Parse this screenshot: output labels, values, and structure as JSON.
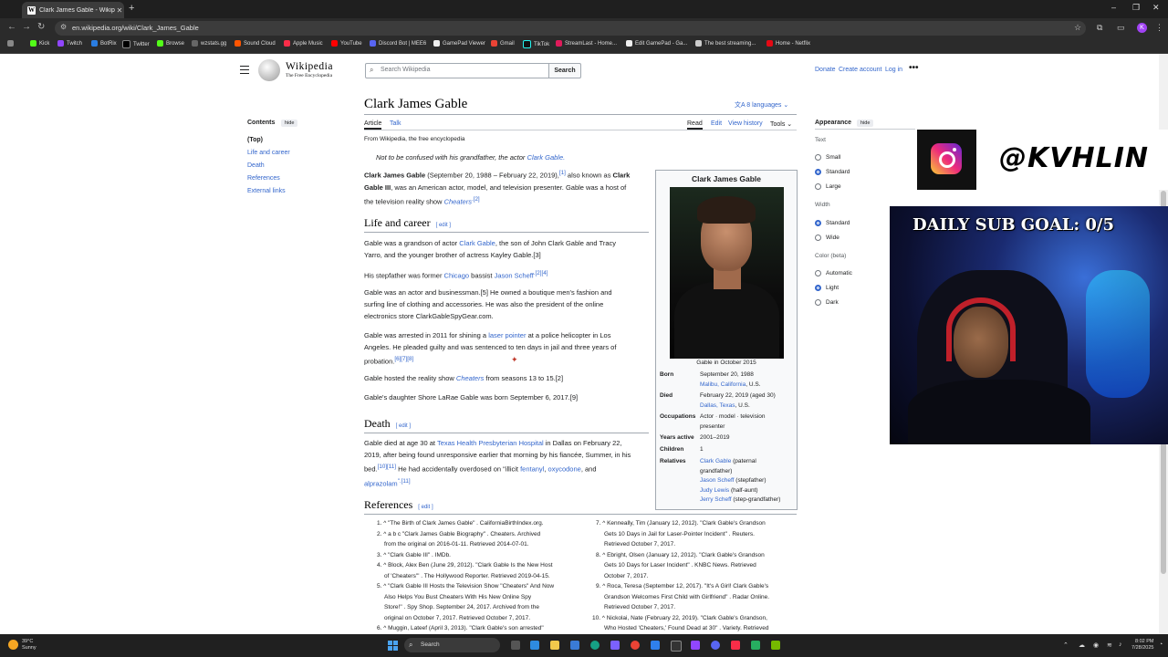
{
  "browser": {
    "tab_title": "Clark James Gable - Wikipedia",
    "url": "en.wikipedia.org/wiki/Clark_James_Gable",
    "bookmarks": [
      "Kick",
      "Twitch",
      "BotRix",
      "Twitter",
      "Browse",
      "wzstats.gg",
      "Sound Cloud",
      "Apple Music",
      "YouTube",
      "Discord Bot | MEE6",
      "GamePad Viewer",
      "Gmail",
      "TikTok",
      "StreamLast - Home...",
      "Edit GamePad - Ga...",
      "The best streaming...",
      "Home - Netflix"
    ],
    "profile_initial": "K"
  },
  "wiki": {
    "wordmark": "Wikipedia",
    "tagline_logo": "The Free Encyclopedia",
    "search_placeholder": "Search Wikipedia",
    "search_button": "Search",
    "top_links": [
      "Donate",
      "Create account",
      "Log in"
    ],
    "toc": {
      "heading": "Contents",
      "hide": "hide",
      "items": [
        "(Top)",
        "Life and career",
        "Death",
        "References",
        "External links"
      ]
    },
    "title": "Clark James Gable",
    "languages": "8 languages",
    "tabs": {
      "article": "Article",
      "talk": "Talk",
      "read": "Read",
      "edit": "Edit",
      "history": "View history",
      "tools": "Tools"
    },
    "from": "From Wikipedia, the free encyclopedia",
    "hatnote_prefix": "Not to be confused with his grandfather, the actor ",
    "hatnote_link": "Clark Gable.",
    "intro": {
      "l1a": "Clark James Gable",
      "l1b": " (September 20, 1988 – February 22, 2019),",
      "l1c": "[1]",
      "l1d": " also known as ",
      "l1e": "Clark",
      "l2a": "Gable III",
      "l2b": ", was an American actor, model, and television presenter. Gable was a host of",
      "l3a": "the television reality show ",
      "l3b": "Cheaters",
      "l3c": ".[2]"
    },
    "sections": {
      "life": "Life and career",
      "death": "Death",
      "references": "References",
      "edit": "[ edit ]"
    },
    "life_paragraphs": {
      "p1l1a": "Gable was a grandson of actor ",
      "p1l1b": "Clark Gable",
      "p1l1c": ", the son of John Clark Gable and Tracy",
      "p1l2": "Yarro, and the younger brother of actress Kayley Gable.[3]",
      "p2a": "His stepfather was former ",
      "p2b": "Chicago",
      "p2c": " bassist ",
      "p2d": "Jason Scheff",
      "p2e": ".[2][4]",
      "p3l1": "Gable was an actor and businessman.[5] He owned a boutique men's fashion and",
      "p3l2": "surfing line of clothing and accessories. He was also the president of the online",
      "p3l3": "electronics store ClarkGableSpyGear.com.",
      "p4l1a": "Gable was arrested in 2011 for shining a ",
      "p4l1b": "laser pointer",
      "p4l1c": " at a police helicopter in Los",
      "p4l2": "Angeles. He pleaded guilty and was sentenced to ten days in jail and three years of",
      "p4l3a": "probation.",
      "p4l3b": "[6][7][8]",
      "p5a": "Gable hosted the reality show ",
      "p5b": "Cheaters",
      "p5c": " from seasons 13 to 15.[2]",
      "p6": "Gable's daughter Shore LaRae Gable was born September 6, 2017.[9]"
    },
    "death_paragraph": {
      "l1a": "Gable died at age 30 at ",
      "l1b": "Texas Health Presbyterian Hospital",
      "l1c": " in Dallas on February 22,",
      "l2": "2019, after being found unresponsive earlier that morning by his fiancée, Summer, in his",
      "l3a": "bed.",
      "l3b": "[10][11]",
      "l3c": " He had accidentally overdosed on \"illicit ",
      "l3d": "fentanyl",
      "l3e": ", ",
      "l3f": "oxycodone",
      "l3g": ", and",
      "l4a": "alprazolam",
      "l4b": "\".[11]"
    },
    "infobox": {
      "title": "Clark James Gable",
      "caption": "Gable in October 2015",
      "born_label": "Born",
      "born_date": "September 20, 1988",
      "born_place_link": "Malibu, California",
      "born_place_rest": ", U.S.",
      "died_label": "Died",
      "died_date": "February 22, 2019 (aged 30)",
      "died_place_link": "Dallas, Texas",
      "died_place_rest": ", U.S.",
      "occ_label": "Occupations",
      "occ_l1": "Actor · model · television",
      "occ_l2": "presenter",
      "years_label": "Years active",
      "years": "2001–2019",
      "children_label": "Children",
      "children": "1",
      "relatives_label": "Relatives",
      "rel1_link": "Clark Gable",
      "rel1_rest": " (paternal",
      "rel1_l2": "grandfather)",
      "rel2_link": "Jason Scheff",
      "rel2_rest": " (stepfather)",
      "rel3_link": "Judy Lewis",
      "rel3_rest": " (half-aunt)",
      "rel4_link": "Jerry Scheff",
      "rel4_rest": " (step-grandfather)"
    },
    "references_left": [
      "1. ^ \"The Birth of Clark James Gable\" . CaliforniaBirthIndex.org.",
      "2. ^ a b c \"Clark James Gable Biography\" . Cheaters. Archived",
      "from the original on 2016-01-11. Retrieved 2014-07-01.",
      "3. ^ \"Clark Gable III\" . IMDb.",
      "4. ^ Block, Alex Ben (June 29, 2012). \"Clark Gable Is the New Host",
      "of 'Cheaters'\" . The Hollywood Reporter. Retrieved 2019-04-15.",
      "5. ^ \"Clark Gable III Hosts the Television Show \"Cheaters\" And Now",
      "Also Helps You Bust Cheaters With His New Online Spy",
      "Store!\" . Spy Shop. September 24, 2017. Archived from the",
      "original on October 7, 2017. Retrieved October 7, 2017.",
      "6. ^ Muggin, Lateef (April 3, 2013). \"Clark Gable's son arrested\""
    ],
    "references_right": [
      "7. ^ Kenneally, Tim (January 12, 2012). \"Clark Gable's Grandson",
      "Gets 10 Days in Jail for Laser-Pointer Incident\" . Reuters.",
      "Retrieved October 7, 2017.",
      "8. ^ Ebright, Olsen (January 12, 2012). \"Clark Gable's Grandson",
      "Gets 10 Days for Laser Incident\" . KNBC News. Retrieved",
      "October 7, 2017.",
      "9. ^ Roca, Teresa (September 12, 2017). \"It's A Girl! Clark Gable's",
      "Grandson Welcomes First Child with Girlfriend\" . Radar Online.",
      "Retrieved October 7, 2017.",
      "10. ^ Nickolai, Nate (February 22, 2019). \"Clark Gable's Grandson,",
      "Who Hosted 'Cheaters,' Found Dead at 30\" . Variety. Retrieved"
    ],
    "appearance": {
      "heading": "Appearance",
      "hide": "hide",
      "text_label": "Text",
      "text_opts": [
        "Small",
        "Standard",
        "Large"
      ],
      "width_label": "Width",
      "width_opts": [
        "Standard",
        "Wide"
      ],
      "color_label": "Color (beta)",
      "color_opts": [
        "Automatic",
        "Light",
        "Dark"
      ]
    }
  },
  "overlay": {
    "handle": "@KVHLIN",
    "goal": "DAILY SUB GOAL: 0/5"
  },
  "taskbar": {
    "temp": "39°C",
    "cond": "Sunny",
    "search": "Search",
    "time": "8:02 PM",
    "date": "7/28/2025"
  },
  "colors": {
    "link": "#3366cc",
    "accent_profile": "#a142f4"
  }
}
